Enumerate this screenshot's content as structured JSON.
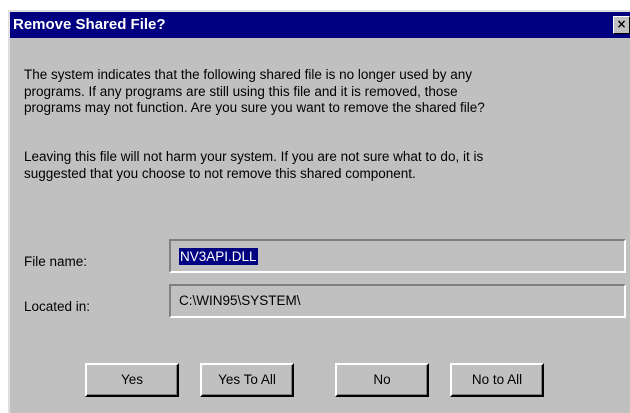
{
  "window": {
    "title": "Remove Shared File?",
    "close_glyph": "×"
  },
  "message": {
    "paragraph1": [
      "The system indicates that the following shared file is no longer used by any",
      "programs.  If any programs are still using this file and it is removed, those",
      "programs may not function.  Are you sure you want to remove the shared file?"
    ],
    "paragraph2": [
      "Leaving this file will not harm your system.  If you are not sure what to do, it is",
      "suggested that you choose to not remove this shared component."
    ]
  },
  "fields": {
    "file_name_label": "File name:",
    "file_name_value": "NV3API.DLL",
    "located_in_label": "Located in:",
    "located_in_value": "C:\\WIN95\\SYSTEM\\"
  },
  "buttons": {
    "yes": "Yes",
    "yes_to_all": "Yes To All",
    "no": "No",
    "no_to_all": "No to All"
  },
  "colors": {
    "titlebar": "#000080",
    "face": "#c0c0c0",
    "selection": "#000080"
  }
}
